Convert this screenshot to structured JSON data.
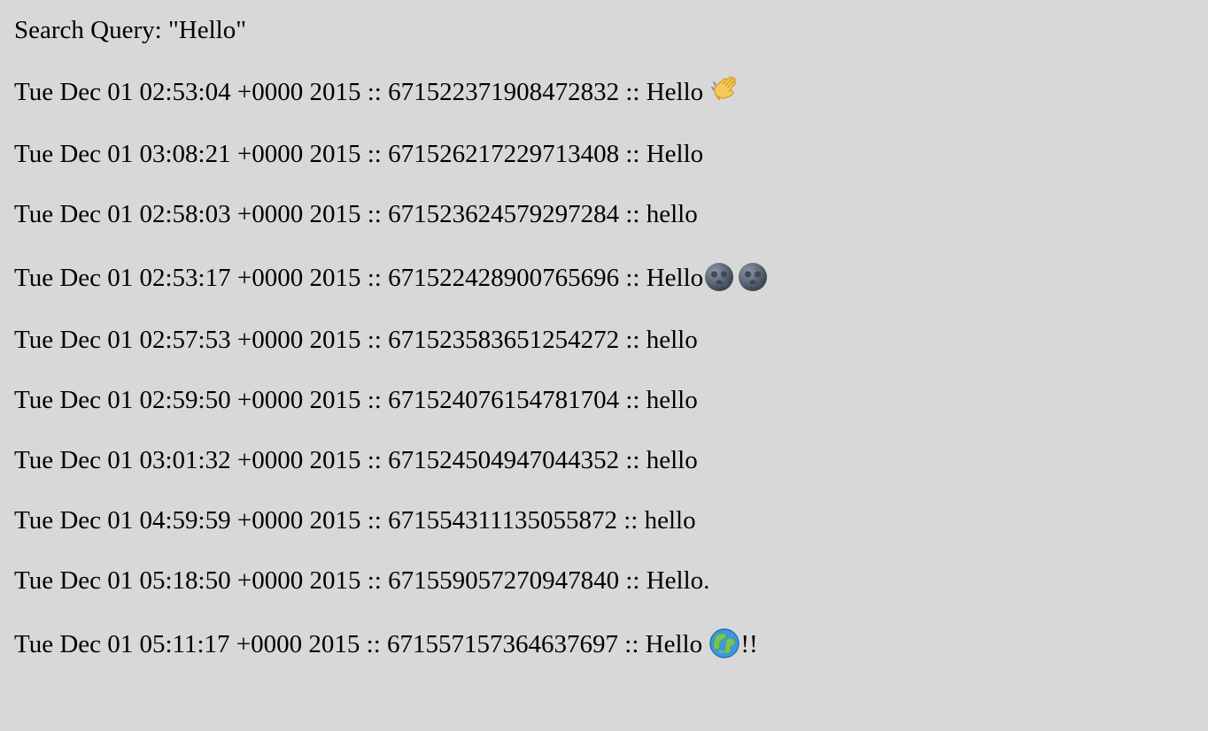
{
  "search": {
    "label": "Search Query:",
    "query_text": "\"Hello\""
  },
  "results": [
    {
      "timestamp": "Tue Dec 01 02:53:04 +0000 2015",
      "separator_1": " :: ",
      "id": "671522371908472832",
      "separator_2": " :: ",
      "text": "Hello ",
      "icons": [
        "waving-hand-icon"
      ],
      "suffix": ""
    },
    {
      "timestamp": "Tue Dec 01 03:08:21 +0000 2015",
      "separator_1": " :: ",
      "id": "671526217229713408",
      "separator_2": " :: ",
      "text": "Hello",
      "icons": [],
      "suffix": ""
    },
    {
      "timestamp": "Tue Dec 01 02:58:03 +0000 2015",
      "separator_1": " :: ",
      "id": "671523624579297284",
      "separator_2": " :: ",
      "text": "hello",
      "icons": [],
      "suffix": ""
    },
    {
      "timestamp": "Tue Dec 01 02:53:17 +0000 2015",
      "separator_1": " :: ",
      "id": "671522428900765696",
      "separator_2": " :: ",
      "text": "Hello",
      "icons": [
        "new-moon-face-icon",
        "new-moon-face-icon"
      ],
      "suffix": ""
    },
    {
      "timestamp": "Tue Dec 01 02:57:53 +0000 2015",
      "separator_1": " :: ",
      "id": "671523583651254272",
      "separator_2": " :: ",
      "text": "hello",
      "icons": [],
      "suffix": ""
    },
    {
      "timestamp": "Tue Dec 01 02:59:50 +0000 2015",
      "separator_1": " :: ",
      "id": "671524076154781704",
      "separator_2": " :: ",
      "text": "hello",
      "icons": [],
      "suffix": ""
    },
    {
      "timestamp": "Tue Dec 01 03:01:32 +0000 2015",
      "separator_1": " :: ",
      "id": "671524504947044352",
      "separator_2": " :: ",
      "text": "hello",
      "icons": [],
      "suffix": ""
    },
    {
      "timestamp": "Tue Dec 01 04:59:59 +0000 2015",
      "separator_1": " :: ",
      "id": "671554311135055872",
      "separator_2": " :: ",
      "text": "hello",
      "icons": [],
      "suffix": ""
    },
    {
      "timestamp": "Tue Dec 01 05:18:50 +0000 2015",
      "separator_1": " :: ",
      "id": "671559057270947840",
      "separator_2": " :: ",
      "text": "Hello.",
      "icons": [],
      "suffix": ""
    },
    {
      "timestamp": "Tue Dec 01 05:11:17 +0000 2015",
      "separator_1": " :: ",
      "id": "671557157364637697",
      "separator_2": " :: ",
      "text": "Hello ",
      "icons": [
        "earth-globe-icon"
      ],
      "suffix": "!!"
    }
  ]
}
